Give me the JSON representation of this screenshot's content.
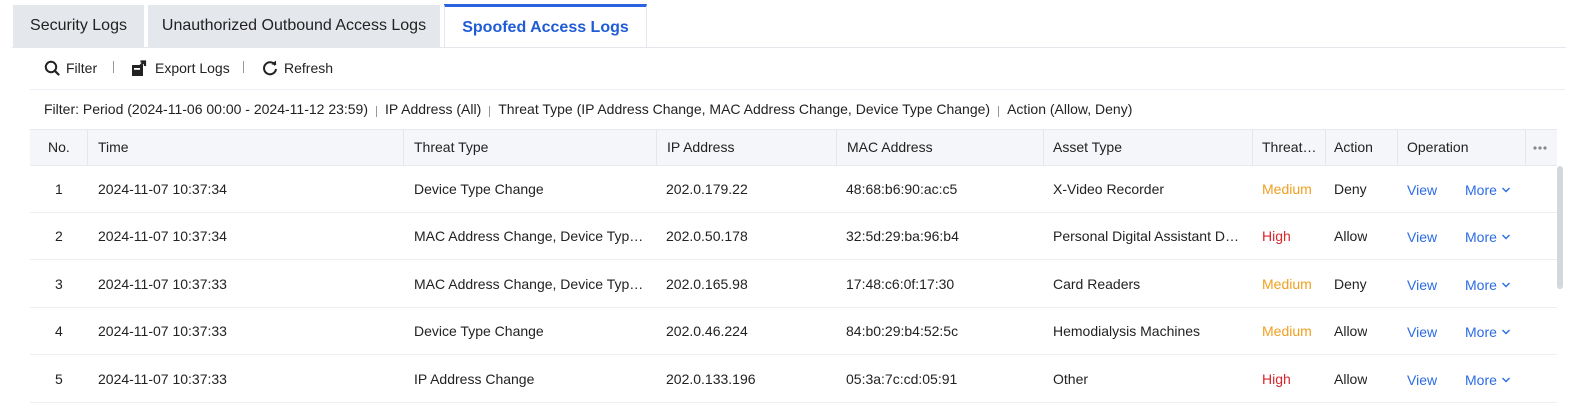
{
  "tabs": [
    {
      "label": "Security Logs",
      "active": false
    },
    {
      "label": "Unauthorized Outbound Access Logs",
      "active": false
    },
    {
      "label": "Spoofed Access Logs",
      "active": true
    }
  ],
  "toolbar": {
    "filter_label": "Filter",
    "export_label": "Export Logs",
    "refresh_label": "Refresh"
  },
  "filter_summary": {
    "period": "Filter: Period (2024-11-06 00:00 - 2024-11-12 23:59)",
    "ip": "IP Address (All)",
    "threat": "Threat Type (IP Address Change, MAC Address Change, Device Type Change)",
    "action": "Action (Allow, Deny)"
  },
  "table": {
    "headers": {
      "no": "No.",
      "time": "Time",
      "threat_type": "Threat Type",
      "ip": "IP Address",
      "mac": "MAC Address",
      "asset": "Asset Type",
      "threat_level": "Threat…",
      "action": "Action",
      "operation": "Operation"
    },
    "rows": [
      {
        "no": "1",
        "time": "2024-11-07 10:37:34",
        "threat_type": "Device Type Change",
        "ip": "202.0.179.22",
        "mac": "48:68:b6:90:ac:c5",
        "asset": "X-Video Recorder",
        "level": "Medium",
        "action": "Deny",
        "view": "View",
        "more": "More"
      },
      {
        "no": "2",
        "time": "2024-11-07 10:37:34",
        "threat_type": "MAC Address Change, Device Type …",
        "ip": "202.0.50.178",
        "mac": "32:5d:29:ba:96:b4",
        "asset": "Personal Digital Assistant De…",
        "level": "High",
        "action": "Allow",
        "view": "View",
        "more": "More"
      },
      {
        "no": "3",
        "time": "2024-11-07 10:37:33",
        "threat_type": "MAC Address Change, Device Type …",
        "ip": "202.0.165.98",
        "mac": "17:48:c6:0f:17:30",
        "asset": "Card Readers",
        "level": "Medium",
        "action": "Deny",
        "view": "View",
        "more": "More"
      },
      {
        "no": "4",
        "time": "2024-11-07 10:37:33",
        "threat_type": "Device Type Change",
        "ip": "202.0.46.224",
        "mac": "84:b0:29:b4:52:5c",
        "asset": "Hemodialysis Machines",
        "level": "Medium",
        "action": "Allow",
        "view": "View",
        "more": "More"
      },
      {
        "no": "5",
        "time": "2024-11-07 10:37:33",
        "threat_type": "IP Address Change",
        "ip": "202.0.133.196",
        "mac": "05:3a:7c:cd:05:91",
        "asset": "Other",
        "level": "High",
        "action": "Allow",
        "view": "View",
        "more": "More"
      }
    ]
  },
  "colors": {
    "accent": "#2b62e0",
    "link": "#2b6be6",
    "medium": "#f0a020",
    "high": "#d9252b"
  },
  "icons": {
    "filter": "search-icon",
    "export": "export-icon",
    "refresh": "refresh-icon",
    "columns": "more-horizontal-icon",
    "more": "chevron-down-icon"
  }
}
